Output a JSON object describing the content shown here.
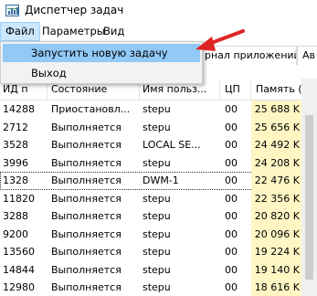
{
  "window": {
    "title": "Диспетчер задач"
  },
  "menu": {
    "items": [
      "Файл",
      "Параметры",
      "Вид"
    ]
  },
  "dropdown": {
    "items": [
      "Запустить новую задачу",
      "Выход"
    ]
  },
  "tabs": [
    "рнал приложений",
    "Ав"
  ],
  "columns": {
    "pid": "ИД п",
    "status": "Состояние",
    "user": "Имя польз...",
    "cpu": "ЦП",
    "memory": "Память (ч"
  },
  "rows": [
    {
      "pid": "14288",
      "status": "Приостановл...",
      "user": "stepu",
      "cpu": "00",
      "memory": "25 688 K"
    },
    {
      "pid": "2712",
      "status": "Выполняется",
      "user": "stepu",
      "cpu": "00",
      "memory": "25 656 K"
    },
    {
      "pid": "3528",
      "status": "Выполняется",
      "user": "LOCAL SE...",
      "cpu": "00",
      "memory": "24 492 K"
    },
    {
      "pid": "3996",
      "status": "Выполняется",
      "user": "stepu",
      "cpu": "00",
      "memory": "24 208 K"
    },
    {
      "pid": "1328",
      "status": "Выполняется",
      "user": "DWM-1",
      "cpu": "00",
      "memory": "22 476 K"
    },
    {
      "pid": "11820",
      "status": "Выполняется",
      "user": "stepu",
      "cpu": "00",
      "memory": "22 356 K"
    },
    {
      "pid": "3288",
      "status": "Выполняется",
      "user": "stepu",
      "cpu": "00",
      "memory": "20 820 K"
    },
    {
      "pid": "9200",
      "status": "Выполняется",
      "user": "stepu",
      "cpu": "00",
      "memory": "20 096 K"
    },
    {
      "pid": "13560",
      "status": "Выполняется",
      "user": "stepu",
      "cpu": "00",
      "memory": "19 224 K"
    },
    {
      "pid": "14844",
      "status": "Выполняется",
      "user": "stepu",
      "cpu": "00",
      "memory": "19 140 K"
    },
    {
      "pid": "12980",
      "status": "Выполняется",
      "user": "stepu",
      "cpu": "00",
      "memory": "18 616 K"
    }
  ],
  "selected_row": 4,
  "colors": {
    "menu_highlight": "#cce8ff",
    "dropdown_highlight": "#91c9f7",
    "memory_column": "#fff6c4",
    "arrow": "#e02424"
  },
  "icons": {
    "app": "task-manager-icon",
    "pointer": "red-arrow-icon"
  }
}
